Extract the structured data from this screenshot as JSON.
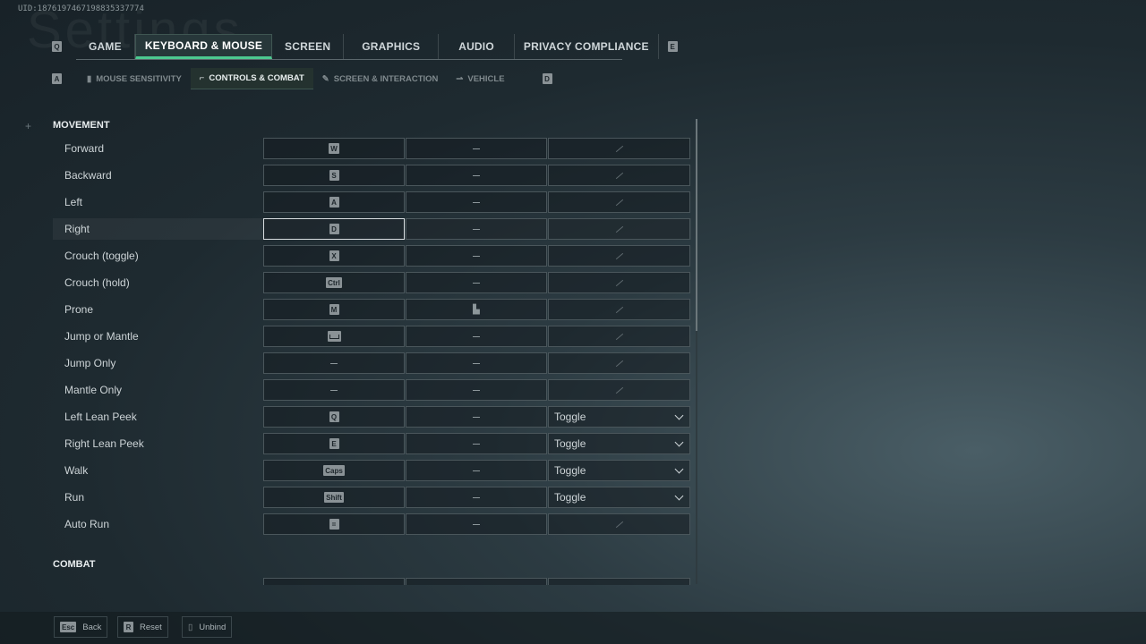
{
  "uid": "UID:1876197467198835337774",
  "title": "Settings",
  "tabs": {
    "left_key": "Q",
    "right_key": "E",
    "items": [
      "GAME",
      "KEYBOARD & MOUSE",
      "SCREEN",
      "GRAPHICS",
      "AUDIO",
      "PRIVACY COMPLIANCE"
    ],
    "active": 1
  },
  "subtabs": {
    "left_key": "A",
    "right_key": "D",
    "items": [
      "MOUSE SENSITIVITY",
      "CONTROLS & COMBAT",
      "SCREEN & INTERACTION",
      "VEHICLE"
    ],
    "active": 1
  },
  "sections": {
    "movement": "MOVEMENT",
    "combat": "COMBAT"
  },
  "rows": [
    {
      "label": "Forward",
      "key": "W",
      "alt": "dash",
      "mode": ""
    },
    {
      "label": "Backward",
      "key": "S",
      "alt": "dash",
      "mode": ""
    },
    {
      "label": "Left",
      "key": "A",
      "alt": "dash",
      "mode": ""
    },
    {
      "label": "Right",
      "key": "D",
      "alt": "dash",
      "mode": ""
    },
    {
      "label": "Crouch (toggle)",
      "key": "X",
      "alt": "dash",
      "mode": ""
    },
    {
      "label": "Crouch (hold)",
      "key": "Ctrl",
      "alt": "dash",
      "mode": ""
    },
    {
      "label": "Prone",
      "key": "M",
      "alt": "mouse-icon",
      "mode": ""
    },
    {
      "label": "Jump or Mantle",
      "key": "Space",
      "alt": "dash",
      "mode": ""
    },
    {
      "label": "Jump Only",
      "key": "",
      "alt": "dash",
      "mode": ""
    },
    {
      "label": "Mantle Only",
      "key": "",
      "alt": "dash",
      "mode": ""
    },
    {
      "label": "Left Lean Peek",
      "key": "Q",
      "alt": "dash",
      "mode": "Toggle"
    },
    {
      "label": "Right Lean Peek",
      "key": "E",
      "alt": "dash",
      "mode": "Toggle"
    },
    {
      "label": "Walk",
      "key": "Caps",
      "alt": "dash",
      "mode": "Toggle"
    },
    {
      "label": "Run",
      "key": "Shift",
      "alt": "dash",
      "mode": "Toggle"
    },
    {
      "label": "Auto Run",
      "key": "=",
      "alt": "dash",
      "mode": ""
    }
  ],
  "footer": [
    {
      "key": "Esc",
      "label": "Back"
    },
    {
      "key": "R",
      "label": "Reset"
    },
    {
      "key": "unbind-icon",
      "label": "Unbind"
    }
  ],
  "colors": {
    "accent": "#4cc890"
  }
}
